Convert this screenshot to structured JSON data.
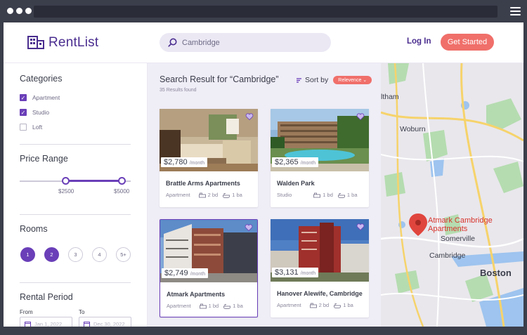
{
  "header": {
    "brand": "RentList",
    "search": {
      "value": "Cambridge"
    },
    "login_label": "Log In",
    "cta_label": "Get Started"
  },
  "filters": {
    "categories_title": "Categories",
    "categories": [
      {
        "label": "Apartment",
        "checked": true
      },
      {
        "label": "Studio",
        "checked": true
      },
      {
        "label": "Loft",
        "checked": false
      }
    ],
    "price_title": "Price Range",
    "price_min": "$2500",
    "price_max": "$5000",
    "rooms_title": "Rooms",
    "rooms": [
      {
        "label": "1",
        "selected": true
      },
      {
        "label": "2",
        "selected": true
      },
      {
        "label": "3",
        "selected": false
      },
      {
        "label": "4",
        "selected": false
      },
      {
        "label": "5+",
        "selected": false
      }
    ],
    "rental_title": "Rental Period",
    "from_label": "From",
    "to_label": "To",
    "from_value": "Jan 1, 2022",
    "to_value": "Dec 30, 2022"
  },
  "results": {
    "title": "Search Result for “Cambridge”",
    "count": "35 Results found",
    "sort_label": "Sort by",
    "sort_value": "Relevence",
    "listings": [
      {
        "price": "$2,780",
        "per": "/month",
        "name": "Brattle Arms Apartments",
        "type": "Apartment",
        "beds": "2 bd",
        "baths": "1 ba",
        "selected": false
      },
      {
        "price": "$2,365",
        "per": "/month",
        "name": "Walden Park",
        "type": "Studio",
        "beds": "1 bd",
        "baths": "1 ba",
        "selected": false
      },
      {
        "price": "$2,749",
        "per": "/month",
        "name": "Atmark  Apartments",
        "type": "Apartment",
        "beds": "1 bd",
        "baths": "1 ba",
        "selected": true
      },
      {
        "price": "$3,131",
        "per": "/month",
        "name": "Hanover Alewife, Cambridge",
        "type": "Apartment",
        "beds": "2 bd",
        "baths": "1 ba",
        "selected": false
      }
    ]
  },
  "map": {
    "labels": {
      "waltham": "ltham",
      "woburn": "Woburn",
      "somerville": "Somerville",
      "cambridge": "Cambridge",
      "boston": "Boston"
    },
    "pin_line1": "Atmark Cambridge",
    "pin_line2": "Apartments"
  },
  "colors": {
    "brand": "#4a2d8f",
    "accent": "#6a3fb8",
    "cta": "#f06f6a",
    "pin": "#d8342c"
  }
}
